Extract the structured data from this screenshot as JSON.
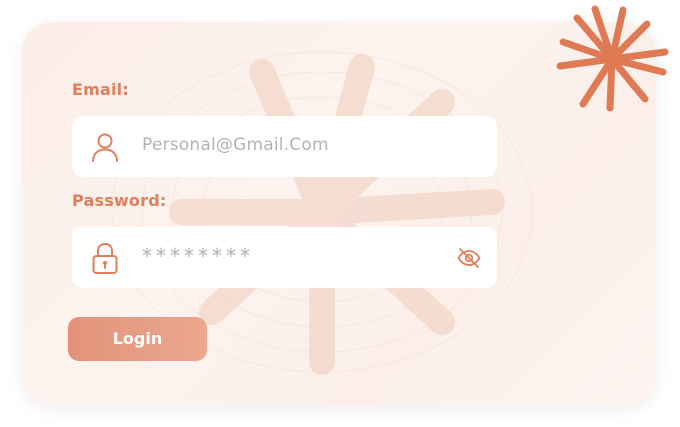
{
  "form": {
    "email_label": "Email:",
    "email_placeholder": "Personal@Gmail.Com",
    "password_label": "Password:",
    "password_value": "********",
    "login_label": "Login"
  },
  "icons": {
    "email": "user-icon",
    "password": "lock-icon",
    "toggle": "eye-slash-icon",
    "decor": "starburst-icon"
  },
  "colors": {
    "accent": "#e07f5c",
    "button": "#e6987f",
    "burst": "#e07a55",
    "card_bg": "#fbede7"
  }
}
